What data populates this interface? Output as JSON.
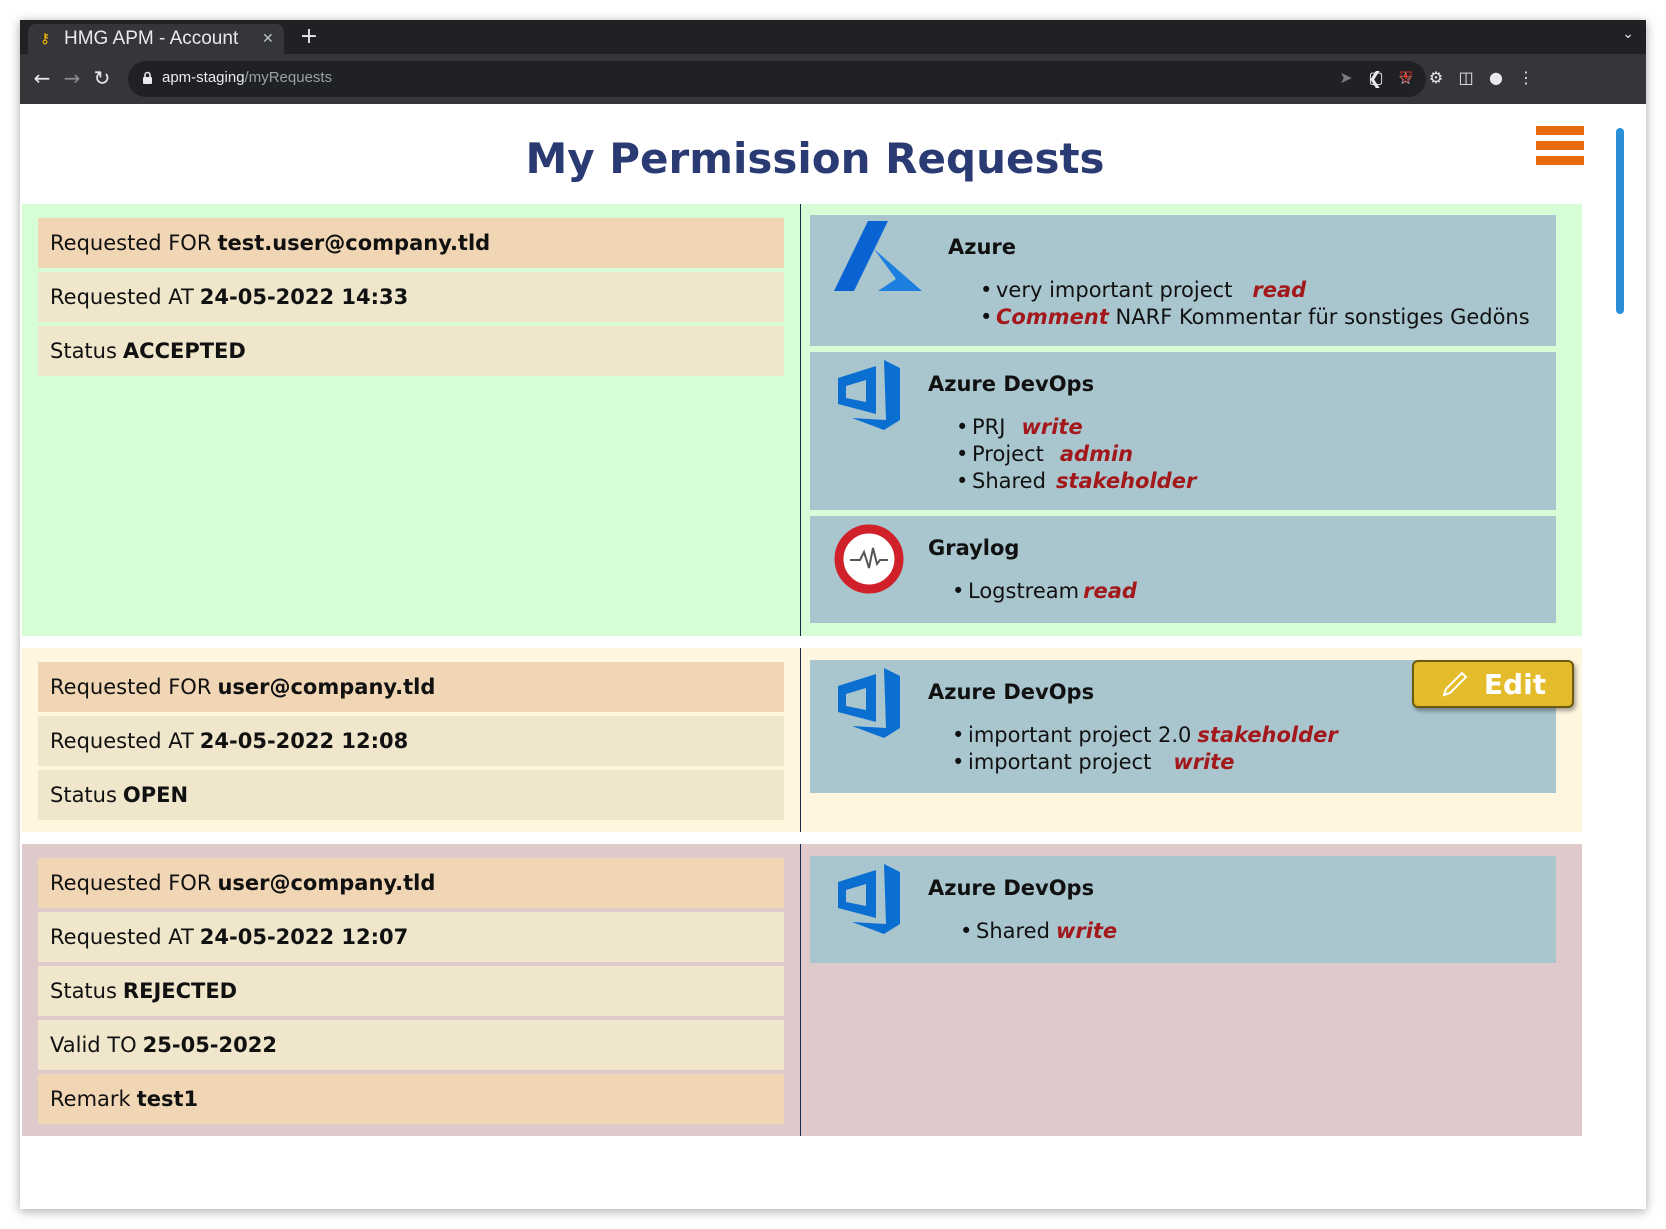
{
  "browser": {
    "tab_title": "HMG APM - Account",
    "url_host": "apm-staging",
    "url_path": "/myRequests"
  },
  "page": {
    "title": "My Permission Requests",
    "edit_label": "Edit"
  },
  "requests": [
    {
      "status_color": "#d7fdd7",
      "fields": [
        {
          "label": "Requested FOR",
          "value": "test.user@company.tld"
        },
        {
          "label": "Requested AT",
          "value": "24-05-2022 14:33"
        },
        {
          "label": "Status",
          "value": "ACCEPTED"
        }
      ],
      "services": [
        {
          "name": "Azure",
          "icon": "azure-icon",
          "items": [
            {
              "text": "very important project",
              "perm": "read"
            },
            {
              "text": "NARF Kommentar für sonstiges Gedöns",
              "perm": "Comment"
            }
          ]
        },
        {
          "name": "Azure DevOps",
          "icon": "azure-devops-icon",
          "items": [
            {
              "text": "PRJ",
              "perm": "write"
            },
            {
              "text": "Project",
              "perm": "admin"
            },
            {
              "text": "Shared",
              "perm": "stakeholder"
            }
          ]
        },
        {
          "name": "Graylog",
          "icon": "graylog-icon",
          "items": [
            {
              "text": "Logstream",
              "perm": "read"
            }
          ]
        }
      ]
    },
    {
      "status_color": "#fff6df",
      "fields": [
        {
          "label": "Requested FOR",
          "value": "user@company.tld"
        },
        {
          "label": "Requested AT",
          "value": "24-05-2022 12:08"
        },
        {
          "label": "Status",
          "value": "OPEN"
        }
      ],
      "services": [
        {
          "name": "Azure DevOps",
          "icon": "azure-devops-icon",
          "items": [
            {
              "text": "important project 2.0",
              "perm": "stakeholder"
            },
            {
              "text": "important project",
              "perm": "write"
            }
          ]
        }
      ]
    },
    {
      "status_color": "#dfcacb",
      "fields": [
        {
          "label": "Requested FOR",
          "value": "user@company.tld"
        },
        {
          "label": "Requested AT",
          "value": "24-05-2022 12:07"
        },
        {
          "label": "Status",
          "value": "REJECTED"
        },
        {
          "label": "Valid TO",
          "value": "25-05-2022"
        },
        {
          "label": "Remark",
          "value": "test1"
        }
      ],
      "services": [
        {
          "name": "Azure DevOps",
          "icon": "azure-devops-icon",
          "items": [
            {
              "text": "Shared",
              "perm": "write"
            }
          ]
        }
      ]
    }
  ]
}
